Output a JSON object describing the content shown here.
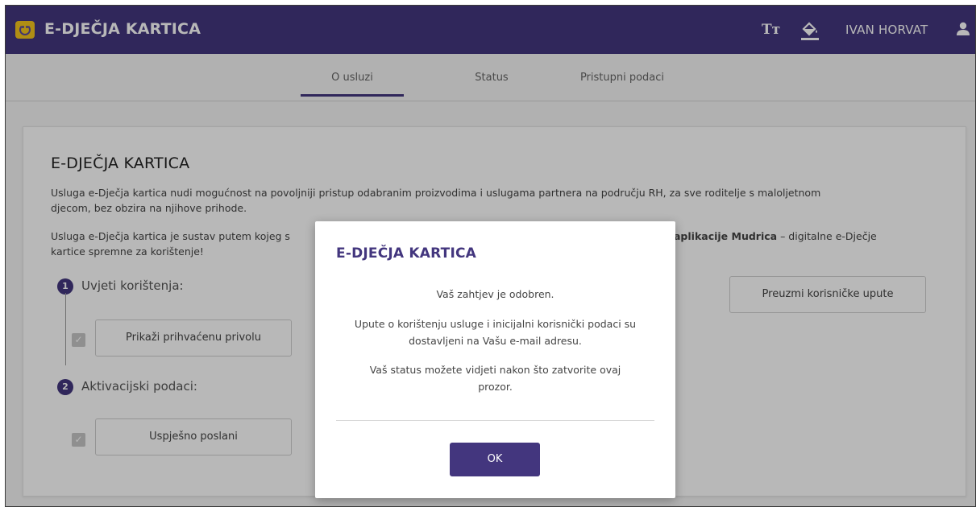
{
  "header": {
    "app_title": "E-DJEČJA KARTICA",
    "font_size_icon": "Tт",
    "username": "IVAN HORVAT",
    "brand_color": "#43367e",
    "logo_color": "#f4c51d"
  },
  "tabs": [
    {
      "label": "O usluzi",
      "active": true
    },
    {
      "label": "Status",
      "active": false
    },
    {
      "label": "Pristupni podaci",
      "active": false
    }
  ],
  "card": {
    "title": "E-DJEČJA KARTICA",
    "para1_line1": "Usluga e-Dječja kartica nudi mogućnost na povoljniji pristup odabranim proizvodima i uslugama partnera na području RH, za sve roditelje s maloljetnom",
    "para1_line2": "djecom, bez obzira na njihove prihode.",
    "para2_start": "Usluga e-Dječja kartica je sustav putem kojeg s",
    "para2_bold": "aplikacije Mudrica",
    "para2_end": " – digitalne e-Dječje",
    "para2_line2": "kartice spremne za korištenje!",
    "download_button": "Preuzmi korisničke upute",
    "steps": [
      {
        "number": "1",
        "label": "Uvjeti korištenja:",
        "button": "Prikaži prihvaćenu privolu",
        "checked": true
      },
      {
        "number": "2",
        "label": "Aktivacijski podaci:",
        "button": "Uspješno poslani",
        "checked": true
      }
    ]
  },
  "modal": {
    "title": "E-DJEČJA KARTICA",
    "message1": "Vaš zahtjev je odobren.",
    "message2_line1": "Upute o korištenju usluge i inicijalni korisnički podaci su",
    "message2_line2": "dostavljeni na Vašu e-mail adresu.",
    "message3_line1": "Vaš status možete vidjeti nakon što zatvorite ovaj",
    "message3_line2": "prozor.",
    "ok_button": "OK"
  }
}
